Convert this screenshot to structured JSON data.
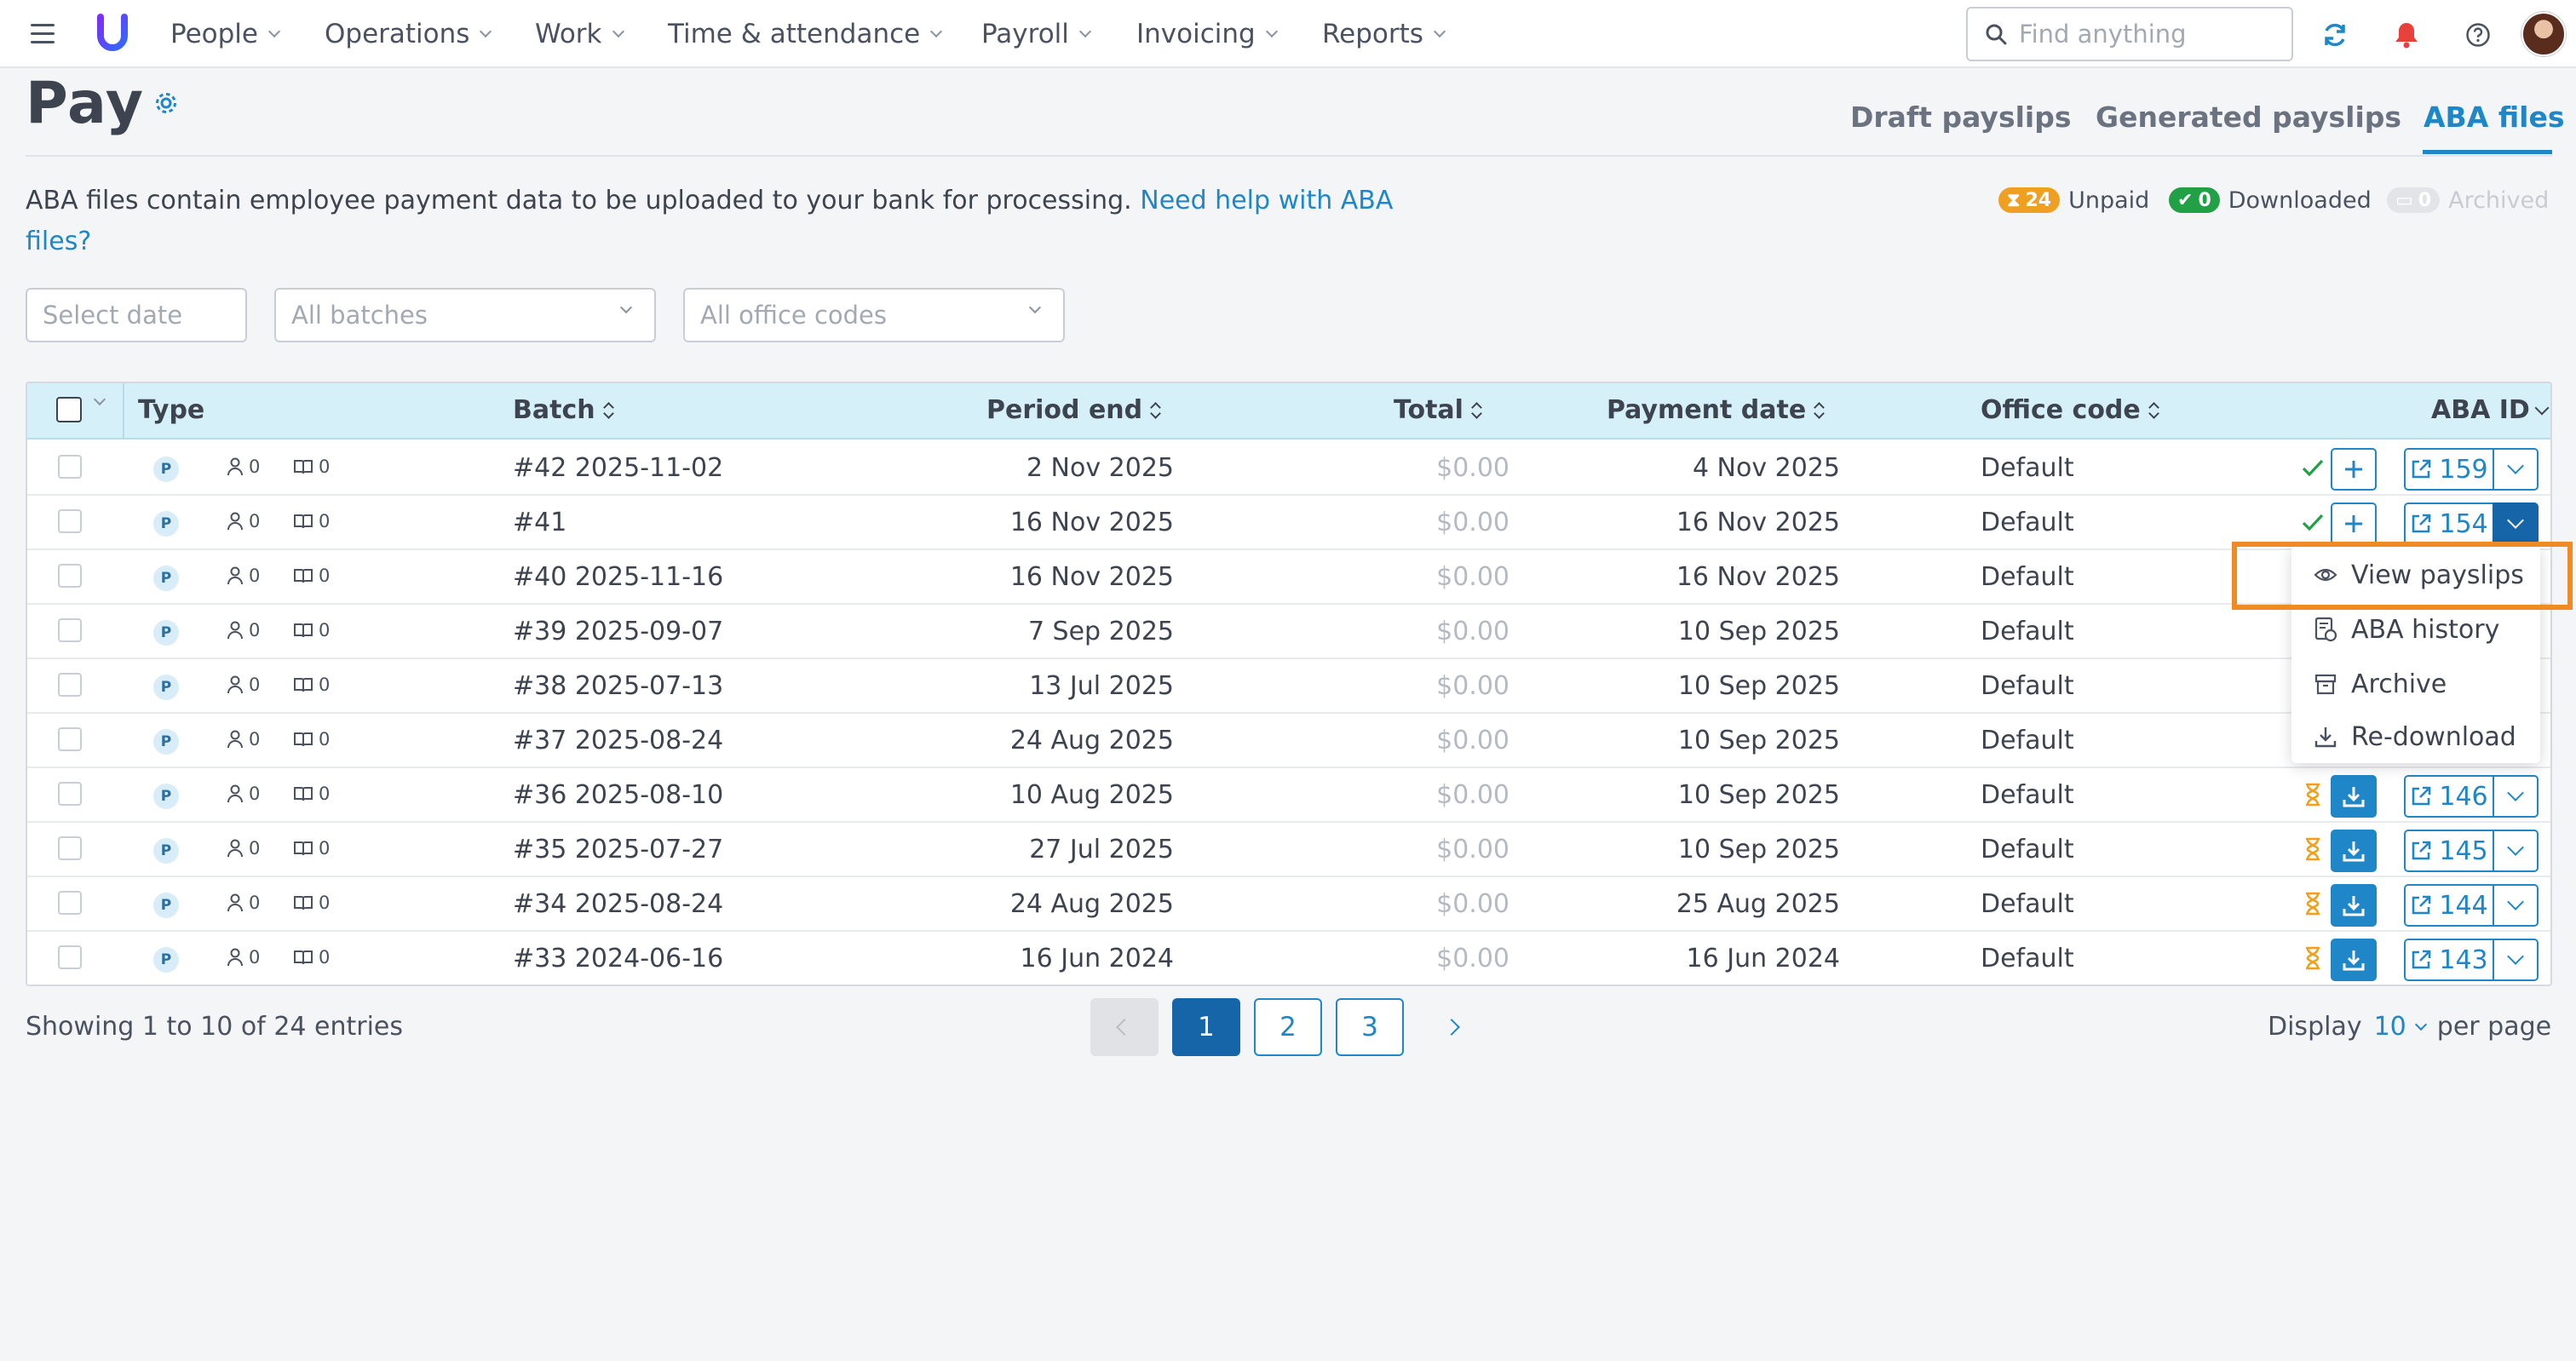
{
  "nav": {
    "items": [
      {
        "label": "People"
      },
      {
        "label": "Operations"
      },
      {
        "label": "Work"
      },
      {
        "label": "Time & attendance"
      },
      {
        "label": "Payroll"
      },
      {
        "label": "Invoicing"
      },
      {
        "label": "Reports"
      }
    ],
    "search_placeholder": "Find anything"
  },
  "page": {
    "title": "Pay",
    "tabs": [
      {
        "label": "Draft payslips",
        "active": false
      },
      {
        "label": "Generated payslips",
        "active": false
      },
      {
        "label": "ABA files",
        "active": true
      }
    ],
    "description": "ABA files contain employee payment data to be uploaded to your bank for processing.",
    "help_link": "Need help with ABA files?",
    "legend": [
      {
        "count": "24",
        "label": "Unpaid",
        "color": "#f0a020"
      },
      {
        "count": "0",
        "label": "Downloaded",
        "color": "#22a046"
      },
      {
        "count": "0",
        "label": "Archived",
        "color": "#e2e4e8"
      }
    ]
  },
  "filters": {
    "date_placeholder": "Select date",
    "batches": "All batches",
    "office_codes": "All office codes"
  },
  "table": {
    "columns": {
      "type": "Type",
      "batch": "Batch",
      "period_end": "Period end",
      "total": "Total",
      "payment_date": "Payment date",
      "office_code": "Office code",
      "aba_id": "ABA ID"
    },
    "rows": [
      {
        "type": "P",
        "employees": "0",
        "books": "0",
        "batch": "#42 2025-11-02",
        "period_end": "2 Nov 2025",
        "total": "$0.00",
        "payment_date": "4 Nov 2025",
        "office_code": "Default",
        "status": "done",
        "aba_id": "159"
      },
      {
        "type": "P",
        "employees": "0",
        "books": "0",
        "batch": "#41",
        "period_end": "16 Nov 2025",
        "total": "$0.00",
        "payment_date": "16 Nov 2025",
        "office_code": "Default",
        "status": "done",
        "aba_id": "154"
      },
      {
        "type": "P",
        "employees": "0",
        "books": "0",
        "batch": "#40 2025-11-16",
        "period_end": "16 Nov 2025",
        "total": "$0.00",
        "payment_date": "16 Nov 2025",
        "office_code": "Default",
        "status": "hidden",
        "aba_id": ""
      },
      {
        "type": "P",
        "employees": "0",
        "books": "0",
        "batch": "#39 2025-09-07",
        "period_end": "7 Sep 2025",
        "total": "$0.00",
        "payment_date": "10 Sep 2025",
        "office_code": "Default",
        "status": "hidden",
        "aba_id": ""
      },
      {
        "type": "P",
        "employees": "0",
        "books": "0",
        "batch": "#38 2025-07-13",
        "period_end": "13 Jul 2025",
        "total": "$0.00",
        "payment_date": "10 Sep 2025",
        "office_code": "Default",
        "status": "hidden",
        "aba_id": ""
      },
      {
        "type": "P",
        "employees": "0",
        "books": "0",
        "batch": "#37 2025-08-24",
        "period_end": "24 Aug 2025",
        "total": "$0.00",
        "payment_date": "10 Sep 2025",
        "office_code": "Default",
        "status": "hidden",
        "aba_id": ""
      },
      {
        "type": "P",
        "employees": "0",
        "books": "0",
        "batch": "#36 2025-08-10",
        "period_end": "10 Aug 2025",
        "total": "$0.00",
        "payment_date": "10 Sep 2025",
        "office_code": "Default",
        "status": "pending",
        "aba_id": "146"
      },
      {
        "type": "P",
        "employees": "0",
        "books": "0",
        "batch": "#35 2025-07-27",
        "period_end": "27 Jul 2025",
        "total": "$0.00",
        "payment_date": "10 Sep 2025",
        "office_code": "Default",
        "status": "pending",
        "aba_id": "145"
      },
      {
        "type": "P",
        "employees": "0",
        "books": "0",
        "batch": "#34 2025-08-24",
        "period_end": "24 Aug 2025",
        "total": "$0.00",
        "payment_date": "25 Aug 2025",
        "office_code": "Default",
        "status": "pending",
        "aba_id": "144"
      },
      {
        "type": "P",
        "employees": "0",
        "books": "0",
        "batch": "#33 2024-06-16",
        "period_end": "16 Jun 2024",
        "total": "$0.00",
        "payment_date": "16 Jun 2024",
        "office_code": "Default",
        "status": "pending",
        "aba_id": "143"
      }
    ]
  },
  "menu": {
    "items": [
      {
        "label": "View payslips",
        "icon": "eye-icon"
      },
      {
        "label": "ABA history",
        "icon": "history-icon"
      },
      {
        "label": "Archive",
        "icon": "archive-icon"
      },
      {
        "label": "Re-download",
        "icon": "download-icon"
      }
    ]
  },
  "footer": {
    "showing": "Showing 1 to 10 of 24 entries",
    "pages": [
      "1",
      "2",
      "3"
    ],
    "display_label": "Display",
    "per_page": "10",
    "per_page_suffix": "per page"
  },
  "colors": {
    "accent": "#1f86c8",
    "highlight": "#f08a24",
    "unpaid": "#f0a020",
    "downloaded": "#22a046"
  }
}
